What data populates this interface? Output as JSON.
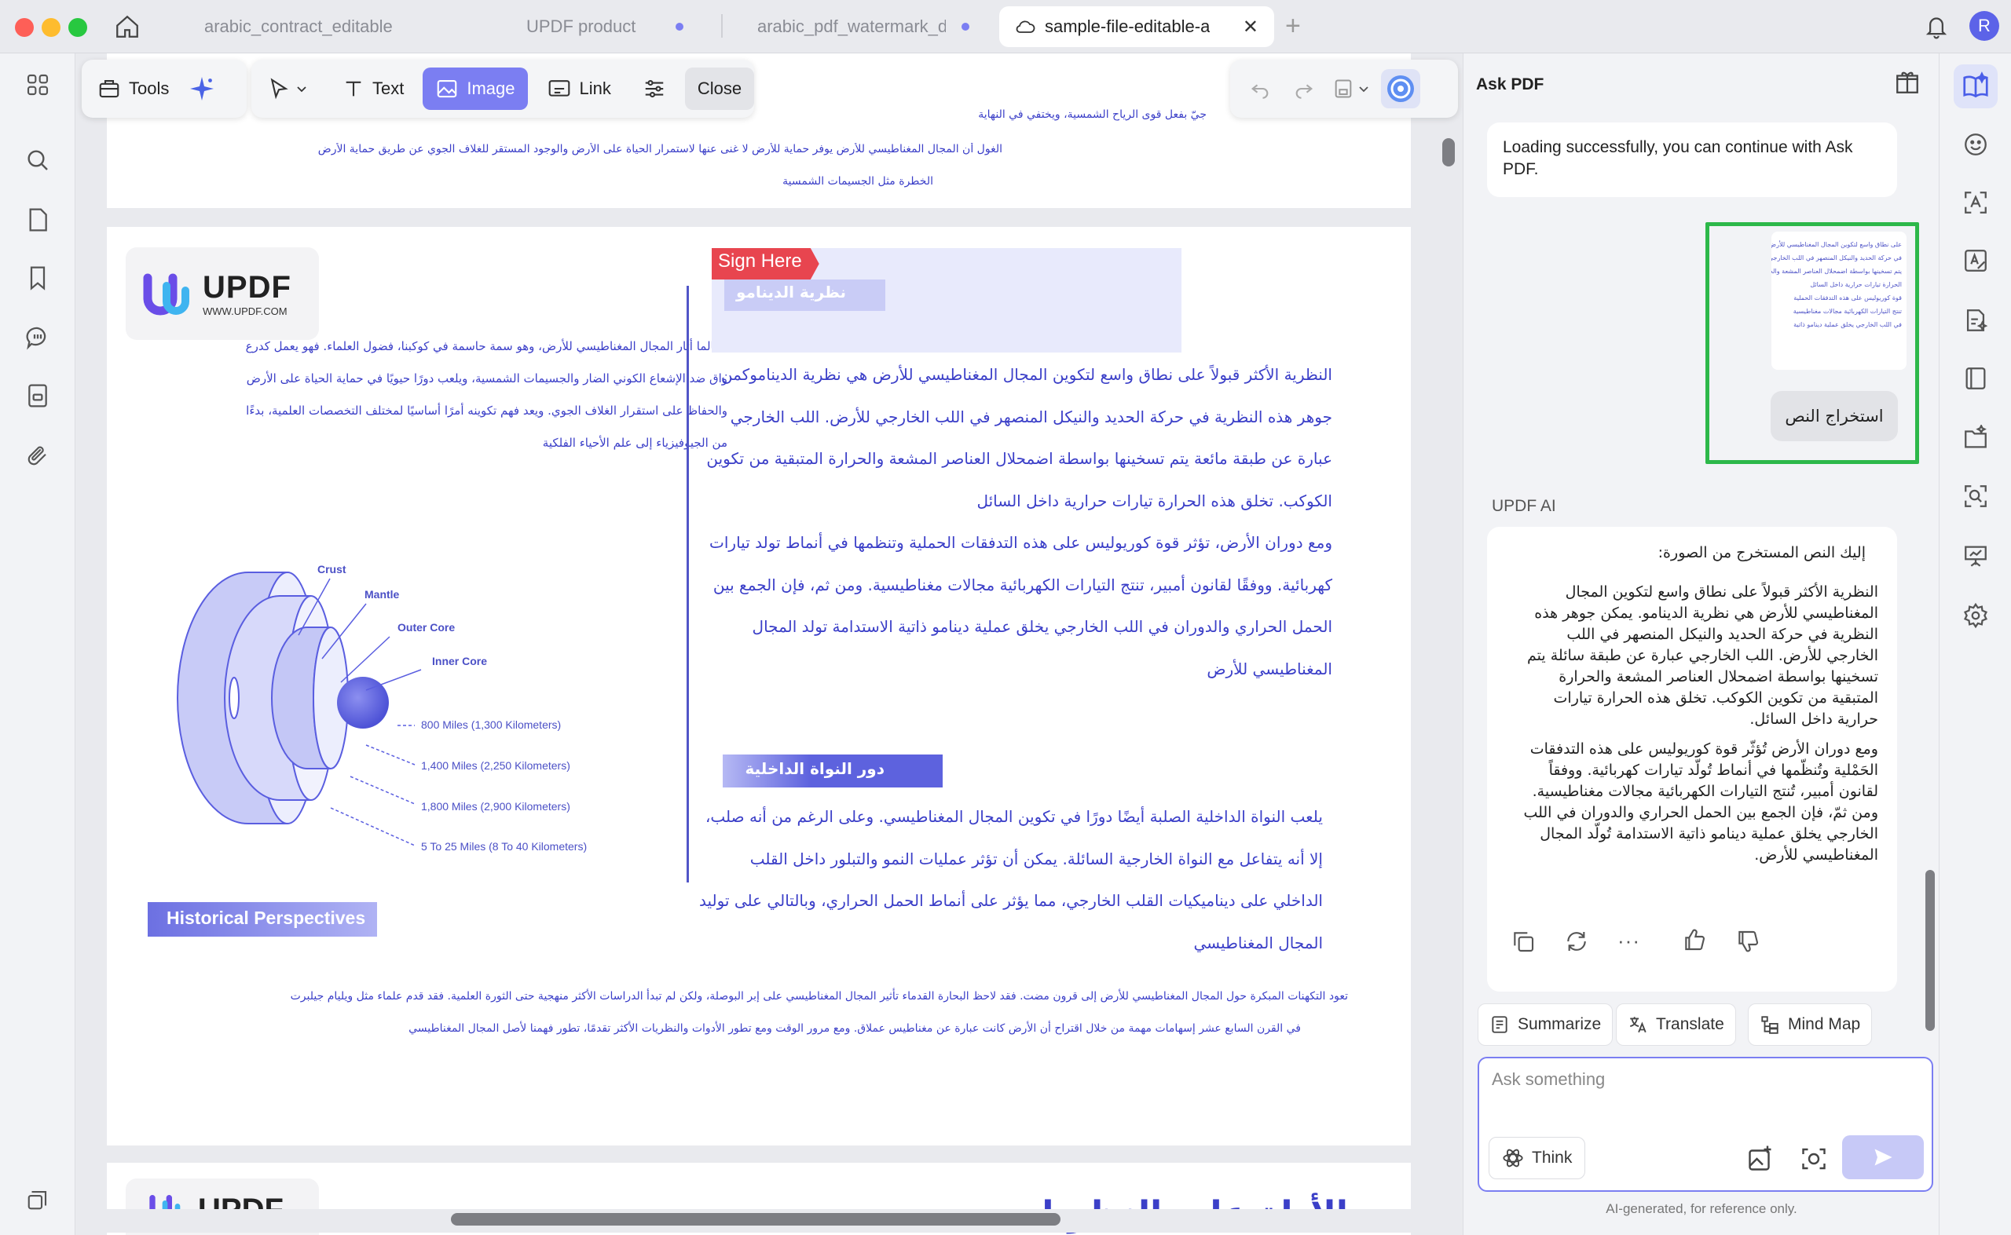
{
  "window": {
    "tabs": [
      {
        "label": "arabic_contract_editable",
        "active": false,
        "modified": false
      },
      {
        "label": "UPDF product",
        "active": false,
        "modified": true
      },
      {
        "label": "arabic_pdf_watermark_de",
        "active": false,
        "modified": true
      },
      {
        "label": "sample-file-editable-a",
        "active": true,
        "modified": false
      }
    ],
    "avatar_letter": "R"
  },
  "toolbar": {
    "tools_label": "Tools",
    "text_label": "Text",
    "image_label": "Image",
    "link_label": "Link",
    "close_label": "Close"
  },
  "document": {
    "top_lines": [
      "جيّ بفعل قوى الرياح الشمسية، ويختفي في النهاية",
      "الغول أن المجال المغناطيسي للأرض يوفر حماية للأرض لا غنى عنها لاستمرار الحياة على الأرض والوجود المستقر للغلاف الجوي عن طريق حماية الأرض",
      "الخطرة مثل الجسيمات الشمسية"
    ],
    "logo": {
      "name": "UPDF",
      "url": "WWW.UPDF.COM"
    },
    "sign_here": "Sign Here",
    "heading_dynamo": "نظرية الدينامو",
    "left_paragraph": [
      "لطالما أثار المجال المغناطيسي للأرض، وهو سمة حاسمة في كوكبنا، فضول العلماء. فهو يعمل كدرع",
      "واق ضد الإشعاع الكوني الضار والجسيمات الشمسية، ويلعب دورًا حيويًا في حماية الحياة على الأرض",
      "والحفاظ على استقرار الغلاف الجوي. ويعد فهم تكوينه أمرًا أساسيًا لمختلف التخصصات العلمية، بدءًا",
      "من الجيوفيزياء إلى علم الأحياء الفلكية"
    ],
    "right_paragraph_1": [
      "النظرية الأكثر قبولاً على نطاق واسع لتكوين المجال المغناطيسي للأرض هي نظرية الديناموكمن",
      "جوهر هذه النظرية في حركة الحديد والنيكل المنصهر في اللب الخارجي للأرض. اللب الخارجي",
      "عبارة عن طبقة مائعة يتم تسخينها بواسطة اضمحلال العناصر المشعة والحرارة المتبقية من تكوين",
      "الكوكب. تخلق هذه الحرارة تيارات حرارية داخل السائل",
      "ومع دوران الأرض، تؤثر قوة كوريوليس على هذه التدفقات الحملية وتنظمها في أنماط تولد تيارات",
      "كهربائية. ووفقًا لقانون أمبير، تنتج التيارات الكهربائية مجالات مغناطيسية. ومن ثم، فإن الجمع بين",
      "الحمل الحراري والدوران في اللب الخارجي يخلق عملية دينامو ذاتية الاستدامة تولد المجال",
      "المغناطيسي للأرض"
    ],
    "heading_inner_core": "دور النواة الداخلية",
    "right_paragraph_2": [
      "يلعب النواة الداخلية الصلبة أيضًا دورًا في تكوين المجال المغناطيسي. وعلى الرغم من أنه صلب،",
      "إلا أنه يتفاعل مع النواة الخارجية السائلة. يمكن أن تؤثر عمليات النمو والتبلور داخل القلب",
      "الداخلي على ديناميكيات القلب الخارجي، مما يؤثر على أنماط الحمل الحراري، وبالتالي على توليد",
      "المجال المغناطيسي"
    ],
    "diagram": {
      "crust": "Crust",
      "mantle": "Mantle",
      "outer_core": "Outer Core",
      "inner_core": "Inner Core",
      "dist_1": "800 Miles (1,300 Kilometers)",
      "dist_2": "1,400 Miles (2,250 Kilometers)",
      "dist_3": "1,800 Miles (2,900 Kilometers)",
      "dist_4": "5 To 25 Miles (8 To 40 Kilometers)"
    },
    "historical_heading": "Historical Perspectives",
    "bottom_lines": [
      "تعود التكهنات المبكرة حول المجال المغناطيسي للأرض إلى قرون مضت. فقد لاحظ البحارة القدماء تأثير المجال المغناطيسي على إبر البوصلة، ولكن لم تبدأ الدراسات الأكثر منهجية حتى الثورة العلمية. فقد قدم علماء مثل ويليام جيلبرت",
      "في القرن السابع عشر إسهامات مهمة من خلال اقتراح أن الأرض كانت عبارة عن مغناطيس عملاق. ومع مرور الوقت ومع تطور الأدوات والنظريات الأكثر تقدمًا، تطور فهمنا لأصل المجال المغناطيسي"
    ],
    "next_page_logo": "UPDF",
    "next_page_heading": "الأدلة على النظريات"
  },
  "ask_pdf": {
    "title": "Ask PDF",
    "loading_message": "Loading successfully, you can continue with Ask PDF.",
    "extract_button": "استخراج النص",
    "thumb_lines": [
      "على نطاق واسع لتكوين المجال المغناطيسي للأرض",
      "في حركة الحديد والنيكل المنصهر في اللب الخارجي",
      "يتم تسخينها بواسطة اضمحلال العناصر المشعة والحرارة",
      "الحرارة تيارات حرارية داخل السائل",
      "قوة كوريوليس على هذه التدفقات الحملية",
      "تنتج التيارات الكهربائية مجالات مغناطيسية",
      "في اللب الخارجي يخلق عملية دينامو ذاتية"
    ],
    "ai_label": "UPDF AI",
    "ai_intro": "إليك النص المستخرج من الصورة:",
    "ai_para_1": [
      "النظرية الأكثر قبولاً على نطاق واسع لتكوين المجال",
      "المغناطيسي للأرض هي نظرية الدينامو. يمكن جوهر هذه",
      "النظرية في حركة الحديد والنيكل المنصهر في اللب",
      "الخارجي للأرض. اللب الخارجي عبارة عن طبقة سائلة يتم",
      "تسخينها بواسطة اضمحلال العناصر المشعة والحرارة",
      "المتبقية من تكوين الكوكب. تخلق هذه الحرارة تيارات",
      "حرارية داخل السائل."
    ],
    "ai_para_2": [
      "ومع دوران الأرض تُؤثّر قوة كوريوليس على هذه التدفقات",
      "الحَمْلية وتُنظّمها في أنماط تُولّد تيارات كهربائية. ووفقاً",
      "لقانون أمبير، تُنتج التيارات الكهربائية مجالات مغناطيسية.",
      "ومن ثمّ، فإن الجمع بين الحمل الحراري والدوران في اللب",
      "الخارجي يخلق عملية دينامو ذاتية الاستدامة تُولّد المجال",
      "المغناطيسي للأرض."
    ],
    "chips": {
      "summarize": "Summarize",
      "translate": "Translate",
      "mind_map": "Mind Map"
    },
    "input_placeholder": "Ask something",
    "think_label": "Think",
    "disclaimer": "AI-generated, for reference only."
  },
  "colors": {
    "accent": "#7b7ef2",
    "doc_text": "#3b3fc8",
    "sign_red": "#e8454f",
    "highlight_green": "#2db84a"
  }
}
